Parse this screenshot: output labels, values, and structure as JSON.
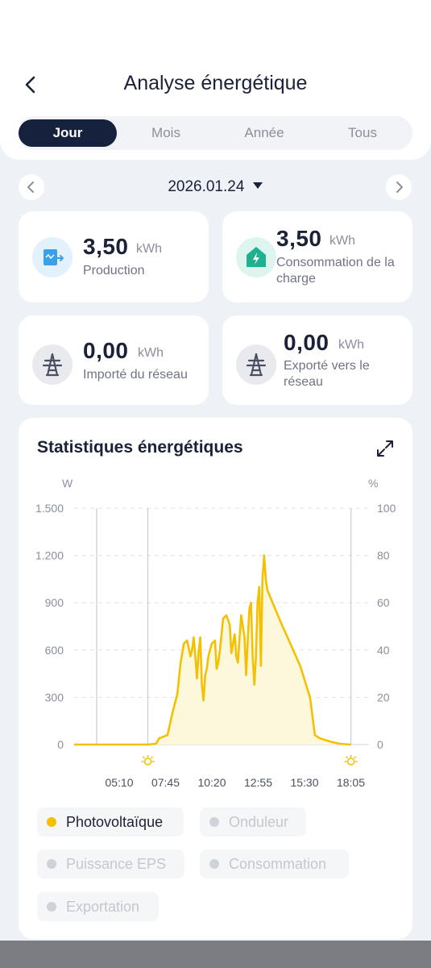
{
  "header": {
    "title": "Analyse énergétique"
  },
  "tabs": [
    {
      "label": "Jour"
    },
    {
      "label": "Mois"
    },
    {
      "label": "Année"
    },
    {
      "label": "Tous"
    }
  ],
  "date": {
    "value": "2026.01.24"
  },
  "cards": {
    "production": {
      "value": "3,50",
      "unit": "kWh",
      "label": "Production"
    },
    "consumption": {
      "value": "3,50",
      "unit": "kWh",
      "label_line1": "Consommation de la",
      "label_line2": "charge"
    },
    "imported": {
      "value": "0,00",
      "unit": "kWh",
      "label": "Importé du réseau"
    },
    "exported": {
      "value": "0,00",
      "unit": "kWh",
      "label_line1": "Exporté vers le",
      "label_line2": "réseau"
    }
  },
  "stats": {
    "title": "Statistiques énergétiques"
  },
  "legend": [
    {
      "label": "Photovoltaïque",
      "active": true
    },
    {
      "label": "Onduleur",
      "active": false
    },
    {
      "label": "Puissance EPS",
      "active": false
    },
    {
      "label": "Consommation",
      "active": false
    },
    {
      "label": "Exportation",
      "active": false
    }
  ],
  "colors": {
    "accent": "#f5c000",
    "dark": "#16213e",
    "production_icon": "#3aa0e8",
    "consumption_icon": "#1fb08f"
  },
  "chart_data": {
    "type": "area",
    "y_left_unit": "W",
    "y_right_unit": "%",
    "y_left_ticks": [
      "1.500",
      "1.200",
      "900",
      "600",
      "300",
      "0"
    ],
    "y_right_ticks": [
      "100",
      "80",
      "60",
      "40",
      "20",
      "0"
    ],
    "ylim_left": [
      0,
      1500
    ],
    "ylim_right": [
      0,
      100
    ],
    "x_ticks": [
      "05:10",
      "07:45",
      "10:20",
      "12:55",
      "15:30",
      "18:05"
    ],
    "xlim": [
      "04:00",
      "19:00"
    ],
    "sunrise": "07:45",
    "sunset": "18:05",
    "series": [
      {
        "name": "Photovoltaïque",
        "points": [
          [
            "04:00",
            0
          ],
          [
            "07:45",
            0
          ],
          [
            "08:10",
            5
          ],
          [
            "08:20",
            40
          ],
          [
            "08:45",
            60
          ],
          [
            "09:00",
            200
          ],
          [
            "09:15",
            320
          ],
          [
            "09:25",
            520
          ],
          [
            "09:35",
            640
          ],
          [
            "09:45",
            660
          ],
          [
            "09:55",
            560
          ],
          [
            "10:00",
            600
          ],
          [
            "10:05",
            680
          ],
          [
            "10:10",
            560
          ],
          [
            "10:15",
            420
          ],
          [
            "10:20",
            580
          ],
          [
            "10:25",
            680
          ],
          [
            "10:30",
            380
          ],
          [
            "10:35",
            280
          ],
          [
            "10:40",
            440
          ],
          [
            "10:45",
            480
          ],
          [
            "10:50",
            560
          ],
          [
            "11:00",
            640
          ],
          [
            "11:10",
            660
          ],
          [
            "11:15",
            480
          ],
          [
            "11:20",
            520
          ],
          [
            "11:25",
            600
          ],
          [
            "11:35",
            800
          ],
          [
            "11:45",
            820
          ],
          [
            "11:55",
            760
          ],
          [
            "12:00",
            580
          ],
          [
            "12:10",
            700
          ],
          [
            "12:15",
            560
          ],
          [
            "12:20",
            520
          ],
          [
            "12:25",
            680
          ],
          [
            "12:30",
            820
          ],
          [
            "12:40",
            680
          ],
          [
            "12:45",
            440
          ],
          [
            "12:50",
            660
          ],
          [
            "12:55",
            860
          ],
          [
            "13:00",
            900
          ],
          [
            "13:05",
            560
          ],
          [
            "13:10",
            380
          ],
          [
            "13:15",
            560
          ],
          [
            "13:20",
            900
          ],
          [
            "13:25",
            1000
          ],
          [
            "13:30",
            500
          ],
          [
            "13:35",
            1050
          ],
          [
            "13:40",
            1200
          ],
          [
            "13:45",
            1050
          ],
          [
            "13:50",
            980
          ],
          [
            "14:30",
            780
          ],
          [
            "15:30",
            500
          ],
          [
            "16:00",
            300
          ],
          [
            "16:15",
            60
          ],
          [
            "16:30",
            40
          ],
          [
            "17:00",
            20
          ],
          [
            "17:30",
            5
          ],
          [
            "18:05",
            0
          ]
        ]
      }
    ]
  }
}
